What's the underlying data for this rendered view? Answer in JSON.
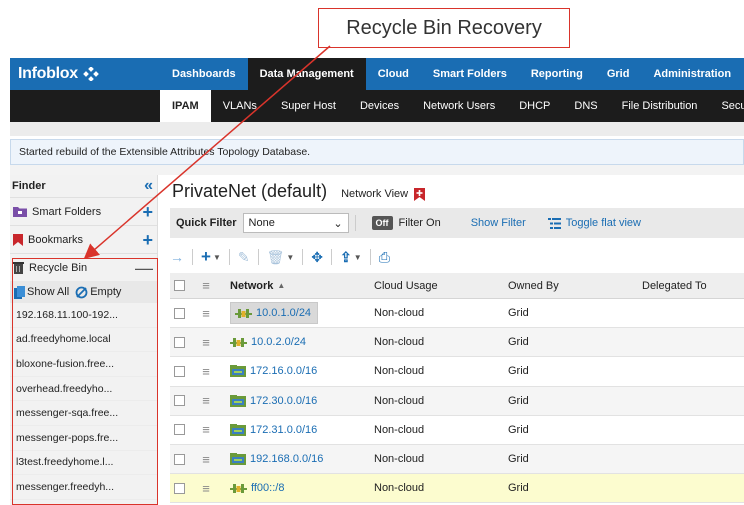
{
  "callout": {
    "text": "Recycle Bin Recovery"
  },
  "brand": {
    "name": "Infoblox",
    "accent": "#1a6db3",
    "annotation_color": "#d9342b"
  },
  "top_nav": [
    "Dashboards",
    "Data Management",
    "Cloud",
    "Smart Folders",
    "Reporting",
    "Grid",
    "Administration"
  ],
  "top_nav_active": "Data Management",
  "sub_nav": [
    "IPAM",
    "VLANs",
    "Super Host",
    "Devices",
    "Network Users",
    "DHCP",
    "DNS",
    "File Distribution",
    "Security"
  ],
  "sub_nav_active": "IPAM",
  "message": "Started rebuild of the Extensible Attributes Topology Database.",
  "sidebar": {
    "finder_title": "Finder",
    "smart_folders": "Smart Folders",
    "bookmarks": "Bookmarks",
    "recycle_bin": "Recycle Bin",
    "show_all": "Show All",
    "empty": "Empty",
    "items": [
      "192.168.11.100-192...",
      "ad.freedyhome.local",
      "bloxone-fusion.free...",
      "overhead.freedyho...",
      "messenger-sqa.free...",
      "messenger-pops.fre...",
      "l3test.freedyhome.l...",
      "messenger.freedyh..."
    ]
  },
  "main": {
    "title": "PrivateNet (default)",
    "network_view_label": "Network View",
    "quick_filter_label": "Quick Filter",
    "quick_filter_value": "None",
    "filter_toggle": "Off",
    "filter_on": "Filter On",
    "show_filter": "Show Filter",
    "toggle_flat_view": "Toggle flat view"
  },
  "table": {
    "columns": [
      "Network",
      "Cloud Usage",
      "Owned By",
      "Delegated To"
    ],
    "rows": [
      {
        "network": "10.0.1.0/24",
        "cloud_usage": "Non-cloud",
        "owned_by": "Grid",
        "icon": "network-icon"
      },
      {
        "network": "10.0.2.0/24",
        "cloud_usage": "Non-cloud",
        "owned_by": "Grid",
        "icon": "network-icon"
      },
      {
        "network": "172.16.0.0/16",
        "cloud_usage": "Non-cloud",
        "owned_by": "Grid",
        "icon": "network-container-icon"
      },
      {
        "network": "172.30.0.0/16",
        "cloud_usage": "Non-cloud",
        "owned_by": "Grid",
        "icon": "network-container-icon"
      },
      {
        "network": "172.31.0.0/16",
        "cloud_usage": "Non-cloud",
        "owned_by": "Grid",
        "icon": "network-container-icon"
      },
      {
        "network": "192.168.0.0/16",
        "cloud_usage": "Non-cloud",
        "owned_by": "Grid",
        "icon": "network-container-icon"
      },
      {
        "network": "ff00::/8",
        "cloud_usage": "Non-cloud",
        "owned_by": "Grid",
        "icon": "network-icon"
      }
    ]
  }
}
